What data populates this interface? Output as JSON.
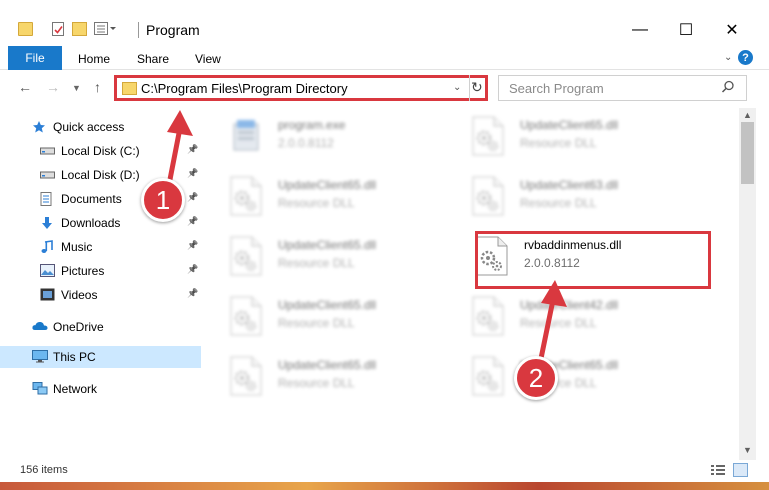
{
  "window": {
    "title": "Program",
    "controls": {
      "minimize": "—",
      "maximize": "☐",
      "close": "✕"
    }
  },
  "ribbon": {
    "tabs": [
      "File",
      "Home",
      "Share",
      "View"
    ],
    "help": "?"
  },
  "address": {
    "path": "C:\\Program Files\\Program Directory",
    "search_placeholder": "Search Program"
  },
  "navpane": {
    "items": [
      {
        "label": "Quick access",
        "icon": "star-icon",
        "pinned": false
      },
      {
        "label": "Local Disk (C:)",
        "icon": "drive-icon",
        "pinned": true
      },
      {
        "label": "Local Disk (D:)",
        "icon": "drive-icon",
        "pinned": true
      },
      {
        "label": "Documents",
        "icon": "documents-icon",
        "pinned": true
      },
      {
        "label": "Downloads",
        "icon": "download-icon",
        "pinned": true
      },
      {
        "label": "Music",
        "icon": "music-icon",
        "pinned": true
      },
      {
        "label": "Pictures",
        "icon": "pictures-icon",
        "pinned": true
      },
      {
        "label": "Videos",
        "icon": "videos-icon",
        "pinned": true
      },
      {
        "label": "OneDrive",
        "icon": "onedrive-icon",
        "pinned": false
      },
      {
        "label": "This PC",
        "icon": "computer-icon",
        "pinned": false,
        "selected": true
      },
      {
        "label": "Network",
        "icon": "network-icon",
        "pinned": false
      }
    ]
  },
  "files": [
    {
      "name": "program.exe",
      "desc": "2.0.0.8112",
      "type": "exe",
      "blurred": true
    },
    {
      "name": "UpdateClient65.dll",
      "desc": "Resource DLL",
      "type": "dll",
      "blurred": true
    },
    {
      "name": "UpdateClient65.dll",
      "desc": "Resource DLL",
      "type": "dll",
      "blurred": true
    },
    {
      "name": "UpdateClient63.dll",
      "desc": "Resource DLL",
      "type": "dll",
      "blurred": true
    },
    {
      "name": "UpdateClient65.dll",
      "desc": "Resource DLL",
      "type": "dll",
      "blurred": true
    },
    {
      "name": "rvbaddinmenus.dll",
      "desc": "2.0.0.8112",
      "type": "dll",
      "blurred": false,
      "highlighted": true
    },
    {
      "name": "UpdateClient65.dll",
      "desc": "Resource DLL",
      "type": "dll",
      "blurred": true
    },
    {
      "name": "UpdateClient42.dll",
      "desc": "Resource DLL",
      "type": "dll",
      "blurred": true
    },
    {
      "name": "UpdateClient65.dll",
      "desc": "Resource DLL",
      "type": "dll",
      "blurred": true
    },
    {
      "name": "UpdateClient65.dll",
      "desc": "Resource DLL",
      "type": "dll",
      "blurred": true
    }
  ],
  "status": {
    "items": "156 items"
  },
  "callouts": [
    "1",
    "2"
  ],
  "colors": {
    "accent": "#1979ca",
    "highlight": "#d9383f",
    "selected_bg": "#cce8ff"
  }
}
